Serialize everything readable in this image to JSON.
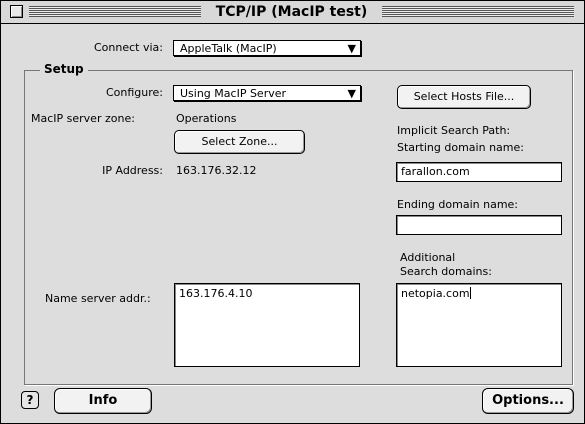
{
  "window": {
    "title": "TCP/IP (MacIP test)"
  },
  "connect": {
    "label": "Connect via:",
    "value": "AppleTalk (MacIP)"
  },
  "setup": {
    "title": "Setup",
    "configure_label": "Configure:",
    "configure_value": "Using MacIP Server",
    "zone_label": "MacIP server zone:",
    "zone_value": "Operations",
    "select_zone_button": "Select Zone...",
    "ip_label": "IP Address:",
    "ip_value": "163.176.32.12",
    "name_server_label": "Name server addr.:",
    "name_server_value": "163.176.4.10",
    "select_hosts_button": "Select Hosts File...",
    "implicit_search_label": "Implicit Search Path:",
    "starting_domain_label": "Starting domain name:",
    "starting_domain_value": "farallon.com",
    "ending_domain_label": "Ending domain name:",
    "ending_domain_value": "",
    "additional_label_1": "Additional",
    "additional_label_2": "Search domains:",
    "additional_value": "netopia.com"
  },
  "footer": {
    "help_icon_glyph": "?",
    "info_button": "Info",
    "options_button": "Options..."
  },
  "colors": {
    "window_bg": "#dddddd",
    "field_bg": "#ffffff"
  }
}
